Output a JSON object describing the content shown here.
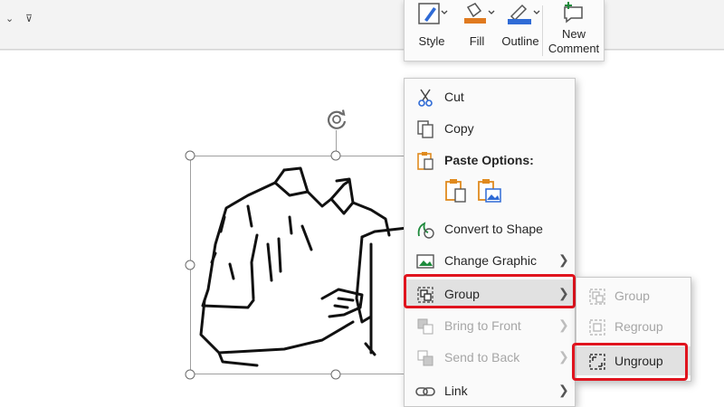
{
  "qat": {
    "chevron1": "⌄",
    "chevron2": "⊽"
  },
  "mini_toolbar": {
    "style_label": "Style",
    "fill_label": "Fill",
    "outline_label": "Outline",
    "new_comment_line1": "New",
    "new_comment_line2": "Comment"
  },
  "context_menu": {
    "cut": "Cut",
    "copy": "Copy",
    "paste_options": "Paste Options:",
    "convert_to_shape": "Convert to Shape",
    "change_graphic": "Change Graphic",
    "group": "Group",
    "bring_to_front": "Bring to Front",
    "send_to_back": "Send to Back",
    "link": "Link"
  },
  "submenu": {
    "group": "Group",
    "regroup": "Regroup",
    "ungroup": "Ungroup"
  },
  "colors": {
    "highlight_red": "#e0141e",
    "fill_orange": "#e07a1f",
    "outline_blue": "#2f6bd6",
    "paste_orange": "#e08a1e"
  }
}
